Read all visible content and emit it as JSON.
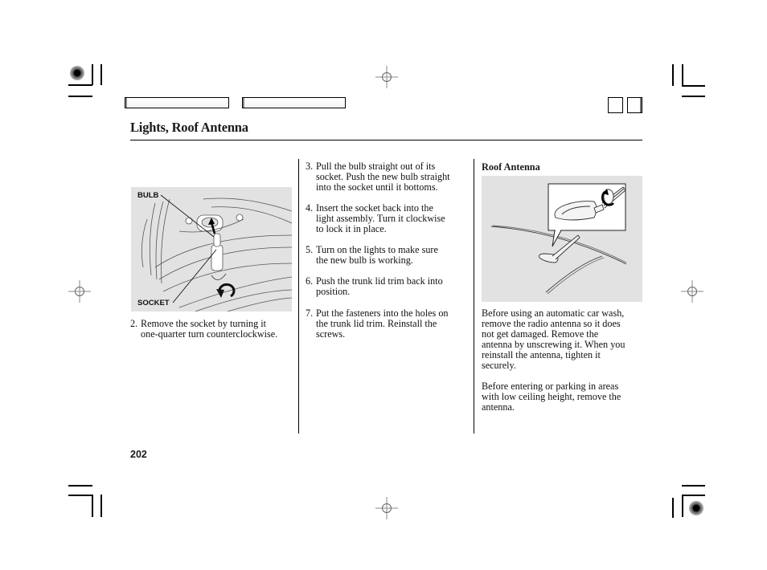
{
  "header": {
    "section_title": "Lights, Roof Antenna",
    "nav_boxes": [
      "",
      ""
    ],
    "corner_boxes": [
      "",
      ""
    ]
  },
  "left_column": {
    "figure": {
      "labels": {
        "bulb": "BULB",
        "socket": "SOCKET"
      },
      "icon": "bulb-socket-illustration"
    },
    "steps": [
      {
        "num": "2.",
        "lines": [
          "Remove the socket by turning it",
          "one-quarter turn counterclockwise."
        ]
      }
    ]
  },
  "middle_column": {
    "steps": [
      {
        "num": "3.",
        "lines": [
          "Pull the bulb straight out of its",
          "socket. Push the new bulb straight",
          "into the socket until it bottoms."
        ]
      },
      {
        "num": "4.",
        "lines": [
          "Insert the socket back into the",
          "light assembly. Turn it clockwise",
          "to lock it in place."
        ]
      },
      {
        "num": "5.",
        "lines": [
          "Turn on the lights to make sure",
          "the new bulb is working."
        ]
      },
      {
        "num": "6.",
        "lines": [
          "Push the trunk lid trim back into",
          "position."
        ]
      },
      {
        "num": "7.",
        "lines": [
          "Put the fasteners into the holes on",
          "the trunk lid trim. Reinstall the",
          "screws."
        ]
      }
    ]
  },
  "right_column": {
    "subheading": "Roof Antenna",
    "figure": {
      "icon": "roof-antenna-illustration"
    },
    "paragraphs": [
      {
        "lines": [
          "Before using an automatic car wash,",
          "remove the radio antenna so it does",
          "not get damaged. Remove the",
          "antenna by unscrewing it. When you",
          "reinstall the antenna, tighten it",
          "securely."
        ]
      },
      {
        "lines": [
          "Before entering or parking in areas",
          "with low ceiling height, remove the",
          "antenna."
        ]
      }
    ]
  },
  "footer": {
    "page_number": "202"
  }
}
